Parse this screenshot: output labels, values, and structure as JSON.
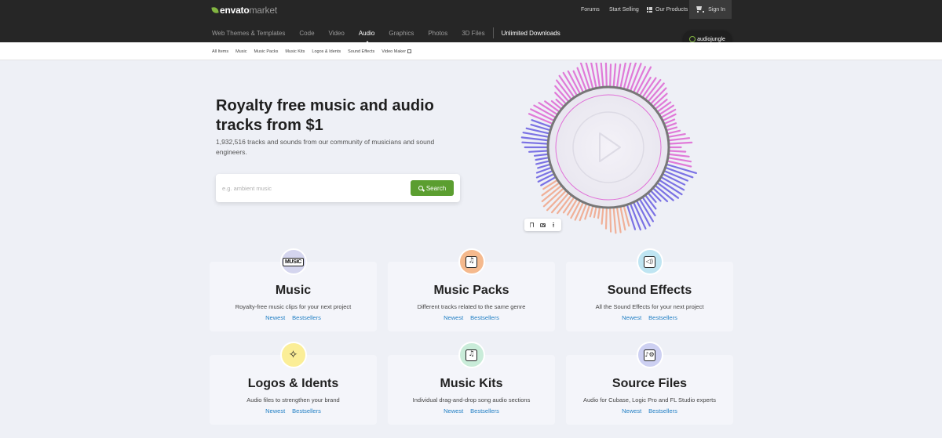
{
  "header": {
    "logo_bold": "envato",
    "logo_light": "market",
    "util_links": [
      "Forums",
      "Start Selling",
      "Our Products"
    ],
    "sign_in": "Sign In",
    "categories": [
      "Web Themes & Templates",
      "Code",
      "Video",
      "Audio",
      "Graphics",
      "Photos",
      "3D Files"
    ],
    "active_category": "Audio",
    "unlimited": "Unlimited Downloads",
    "badge": "audiojungle"
  },
  "subnav": {
    "items": [
      "All Items",
      "Music",
      "Music Packs",
      "Music Kits",
      "Logos & Idents",
      "Sound Effects",
      "Video Maker"
    ]
  },
  "hero": {
    "title": "Royalty free music and audio tracks from $1",
    "subtitle": "1,932,516 tracks and sounds from our community of musicians and sound engineers.",
    "search_placeholder": "e.g. ambient music",
    "search_button": "Search"
  },
  "cards": [
    {
      "title": "Music",
      "desc": "Royalty-free music clips for your next project",
      "icon": "music-text-icon",
      "icon_color": "#d4d5ee",
      "link1": "Newest",
      "link2": "Bestsellers"
    },
    {
      "title": "Music Packs",
      "desc": "Different tracks related to the same genre",
      "icon": "music-packs-icon",
      "icon_color": "#f5b98d",
      "link1": "Newest",
      "link2": "Bestsellers"
    },
    {
      "title": "Sound Effects",
      "desc": "All the Sound Effects for your next project",
      "icon": "speaker-icon",
      "icon_color": "#bfe5f2",
      "link1": "Newest",
      "link2": "Bestsellers"
    },
    {
      "title": "Logos & Idents",
      "desc": "Audio files to strengthen your brand",
      "icon": "sparkle-icon",
      "icon_color": "#fbee97",
      "link1": "Newest",
      "link2": "Bestsellers"
    },
    {
      "title": "Music Kits",
      "desc": "Individual drag-and-drop song audio sections",
      "icon": "music-kit-icon",
      "icon_color": "#c9ecd9",
      "link1": "Newest",
      "link2": "Bestsellers"
    },
    {
      "title": "Source Files",
      "desc": "Audio for Cubase, Logic Pro and FL Studio experts",
      "icon": "source-file-gear-icon",
      "icon_color": "#cdd0f2",
      "link1": "Newest",
      "link2": "Bestsellers"
    }
  ],
  "colors": {
    "header_bg": "#262626",
    "accent_green": "#5b9e30",
    "link_blue": "#1f7ec4",
    "wave_purple": "#7b72e4",
    "wave_pink": "#e07ad8",
    "wave_peach": "#f0b098"
  }
}
